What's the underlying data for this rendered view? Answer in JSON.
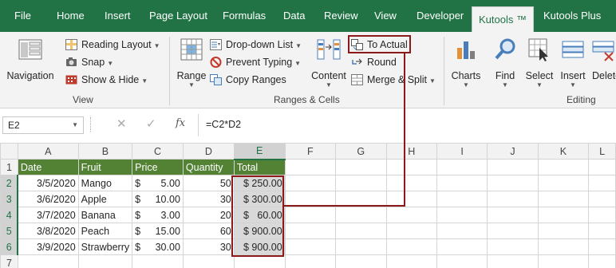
{
  "tabs": [
    "File",
    "Home",
    "Insert",
    "Page Layout",
    "Formulas",
    "Data",
    "Review",
    "View",
    "Developer",
    "Kutools ™",
    "Kutools Plus"
  ],
  "ribbon": {
    "navigation": "Navigation",
    "reading_layout": "Reading Layout",
    "snap": "Snap",
    "show_hide": "Show & Hide",
    "view_group": "View",
    "range": "Range",
    "dropdown_list": "Drop-down List",
    "prevent_typing": "Prevent Typing",
    "copy_ranges": "Copy Ranges",
    "content": "Content",
    "to_actual": "To Actual",
    "round": "Round",
    "merge_split": "Merge & Split",
    "ranges_cells_group": "Ranges & Cells",
    "charts": "Charts",
    "find": "Find",
    "select": "Select",
    "insert": "Insert",
    "delete": "Delete",
    "editing_group": "Editing"
  },
  "formula_bar": {
    "name_box": "E2",
    "fx": "fx",
    "formula": "=C2*D2"
  },
  "columns": [
    "A",
    "B",
    "C",
    "D",
    "E",
    "F",
    "G",
    "H",
    "I",
    "J",
    "K",
    "L"
  ],
  "headers": [
    "Date",
    "Fruit",
    "Price",
    "Quantity",
    "Total"
  ],
  "rows": [
    {
      "n": "1"
    },
    {
      "n": "2",
      "date": "3/5/2020",
      "fruit": "Mango",
      "price": "5.00",
      "qty": "50",
      "total": "$ 250.00"
    },
    {
      "n": "3",
      "date": "3/6/2020",
      "fruit": "Apple",
      "price": "10.00",
      "qty": "30",
      "total": "$ 300.00"
    },
    {
      "n": "4",
      "date": "3/7/2020",
      "fruit": "Banana",
      "price": "3.00",
      "qty": "20",
      "total": "$   60.00"
    },
    {
      "n": "5",
      "date": "3/8/2020",
      "fruit": "Peach",
      "price": "15.00",
      "qty": "60",
      "total": "$ 900.00"
    },
    {
      "n": "6",
      "date": "3/9/2020",
      "fruit": "Strawberry",
      "price": "30.00",
      "qty": "30",
      "total": "$ 900.00"
    },
    {
      "n": "7"
    }
  ],
  "currency": "$",
  "colors": {
    "excel_green": "#217346",
    "header_fill": "#548235",
    "highlight": "#8b1a1a",
    "selected_fill": "#d9d9d9"
  }
}
